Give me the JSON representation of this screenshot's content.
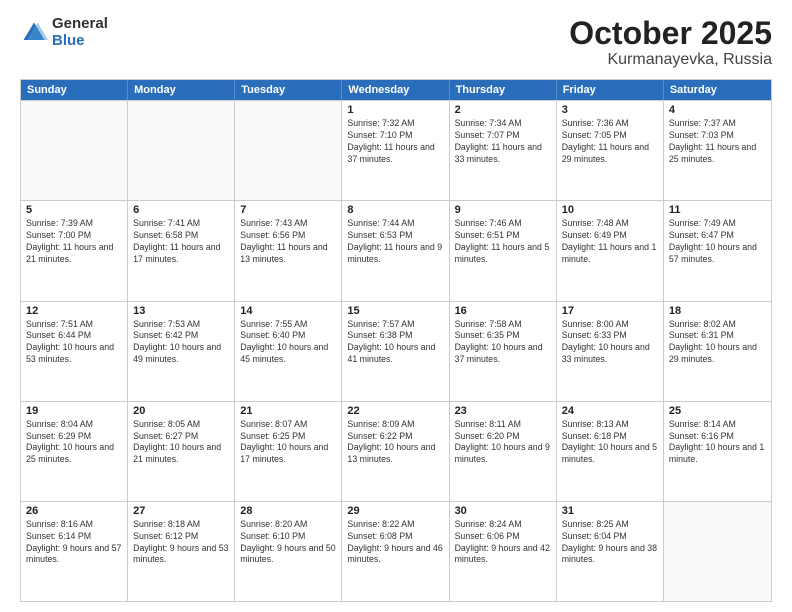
{
  "header": {
    "logo": {
      "general": "General",
      "blue": "Blue"
    },
    "title": "October 2025",
    "location": "Kurmanayevka, Russia"
  },
  "weekdays": [
    "Sunday",
    "Monday",
    "Tuesday",
    "Wednesday",
    "Thursday",
    "Friday",
    "Saturday"
  ],
  "weeks": [
    [
      {
        "day": "",
        "info": ""
      },
      {
        "day": "",
        "info": ""
      },
      {
        "day": "",
        "info": ""
      },
      {
        "day": "1",
        "info": "Sunrise: 7:32 AM\nSunset: 7:10 PM\nDaylight: 11 hours and 37 minutes."
      },
      {
        "day": "2",
        "info": "Sunrise: 7:34 AM\nSunset: 7:07 PM\nDaylight: 11 hours and 33 minutes."
      },
      {
        "day": "3",
        "info": "Sunrise: 7:36 AM\nSunset: 7:05 PM\nDaylight: 11 hours and 29 minutes."
      },
      {
        "day": "4",
        "info": "Sunrise: 7:37 AM\nSunset: 7:03 PM\nDaylight: 11 hours and 25 minutes."
      }
    ],
    [
      {
        "day": "5",
        "info": "Sunrise: 7:39 AM\nSunset: 7:00 PM\nDaylight: 11 hours and 21 minutes."
      },
      {
        "day": "6",
        "info": "Sunrise: 7:41 AM\nSunset: 6:58 PM\nDaylight: 11 hours and 17 minutes."
      },
      {
        "day": "7",
        "info": "Sunrise: 7:43 AM\nSunset: 6:56 PM\nDaylight: 11 hours and 13 minutes."
      },
      {
        "day": "8",
        "info": "Sunrise: 7:44 AM\nSunset: 6:53 PM\nDaylight: 11 hours and 9 minutes."
      },
      {
        "day": "9",
        "info": "Sunrise: 7:46 AM\nSunset: 6:51 PM\nDaylight: 11 hours and 5 minutes."
      },
      {
        "day": "10",
        "info": "Sunrise: 7:48 AM\nSunset: 6:49 PM\nDaylight: 11 hours and 1 minute."
      },
      {
        "day": "11",
        "info": "Sunrise: 7:49 AM\nSunset: 6:47 PM\nDaylight: 10 hours and 57 minutes."
      }
    ],
    [
      {
        "day": "12",
        "info": "Sunrise: 7:51 AM\nSunset: 6:44 PM\nDaylight: 10 hours and 53 minutes."
      },
      {
        "day": "13",
        "info": "Sunrise: 7:53 AM\nSunset: 6:42 PM\nDaylight: 10 hours and 49 minutes."
      },
      {
        "day": "14",
        "info": "Sunrise: 7:55 AM\nSunset: 6:40 PM\nDaylight: 10 hours and 45 minutes."
      },
      {
        "day": "15",
        "info": "Sunrise: 7:57 AM\nSunset: 6:38 PM\nDaylight: 10 hours and 41 minutes."
      },
      {
        "day": "16",
        "info": "Sunrise: 7:58 AM\nSunset: 6:35 PM\nDaylight: 10 hours and 37 minutes."
      },
      {
        "day": "17",
        "info": "Sunrise: 8:00 AM\nSunset: 6:33 PM\nDaylight: 10 hours and 33 minutes."
      },
      {
        "day": "18",
        "info": "Sunrise: 8:02 AM\nSunset: 6:31 PM\nDaylight: 10 hours and 29 minutes."
      }
    ],
    [
      {
        "day": "19",
        "info": "Sunrise: 8:04 AM\nSunset: 6:29 PM\nDaylight: 10 hours and 25 minutes."
      },
      {
        "day": "20",
        "info": "Sunrise: 8:05 AM\nSunset: 6:27 PM\nDaylight: 10 hours and 21 minutes."
      },
      {
        "day": "21",
        "info": "Sunrise: 8:07 AM\nSunset: 6:25 PM\nDaylight: 10 hours and 17 minutes."
      },
      {
        "day": "22",
        "info": "Sunrise: 8:09 AM\nSunset: 6:22 PM\nDaylight: 10 hours and 13 minutes."
      },
      {
        "day": "23",
        "info": "Sunrise: 8:11 AM\nSunset: 6:20 PM\nDaylight: 10 hours and 9 minutes."
      },
      {
        "day": "24",
        "info": "Sunrise: 8:13 AM\nSunset: 6:18 PM\nDaylight: 10 hours and 5 minutes."
      },
      {
        "day": "25",
        "info": "Sunrise: 8:14 AM\nSunset: 6:16 PM\nDaylight: 10 hours and 1 minute."
      }
    ],
    [
      {
        "day": "26",
        "info": "Sunrise: 8:16 AM\nSunset: 6:14 PM\nDaylight: 9 hours and 57 minutes."
      },
      {
        "day": "27",
        "info": "Sunrise: 8:18 AM\nSunset: 6:12 PM\nDaylight: 9 hours and 53 minutes."
      },
      {
        "day": "28",
        "info": "Sunrise: 8:20 AM\nSunset: 6:10 PM\nDaylight: 9 hours and 50 minutes."
      },
      {
        "day": "29",
        "info": "Sunrise: 8:22 AM\nSunset: 6:08 PM\nDaylight: 9 hours and 46 minutes."
      },
      {
        "day": "30",
        "info": "Sunrise: 8:24 AM\nSunset: 6:06 PM\nDaylight: 9 hours and 42 minutes."
      },
      {
        "day": "31",
        "info": "Sunrise: 8:25 AM\nSunset: 6:04 PM\nDaylight: 9 hours and 38 minutes."
      },
      {
        "day": "",
        "info": ""
      }
    ]
  ]
}
